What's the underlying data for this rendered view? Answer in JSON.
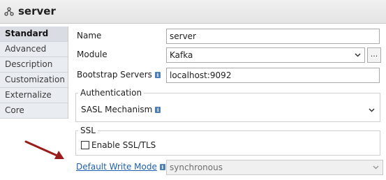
{
  "header": {
    "title": "server",
    "icon": "component-icon"
  },
  "tabs": [
    {
      "label": "Standard",
      "active": true
    },
    {
      "label": "Advanced",
      "active": false
    },
    {
      "label": "Description",
      "active": false
    },
    {
      "label": "Customization",
      "active": false
    },
    {
      "label": "Externalize",
      "active": false
    },
    {
      "label": "Core",
      "active": false
    }
  ],
  "form": {
    "name_label": "Name",
    "name_value": "server",
    "module_label": "Module",
    "module_value": "Kafka",
    "module_button": "...",
    "bootstrap_label": "Bootstrap Servers",
    "bootstrap_value": "localhost:9092",
    "auth_group_title": "Authentication",
    "sasl_label": "SASL Mechanism",
    "sasl_value": "",
    "ssl_group_title": "SSL",
    "ssl_checkbox_label": "Enable SSL/TLS",
    "ssl_checked": false,
    "write_mode_label": "Default Write Mode",
    "write_mode_value": "synchronous"
  },
  "colors": {
    "link": "#1f5fae",
    "annotation_arrow": "#9b1c1c",
    "info_icon": "#4f80b5"
  }
}
